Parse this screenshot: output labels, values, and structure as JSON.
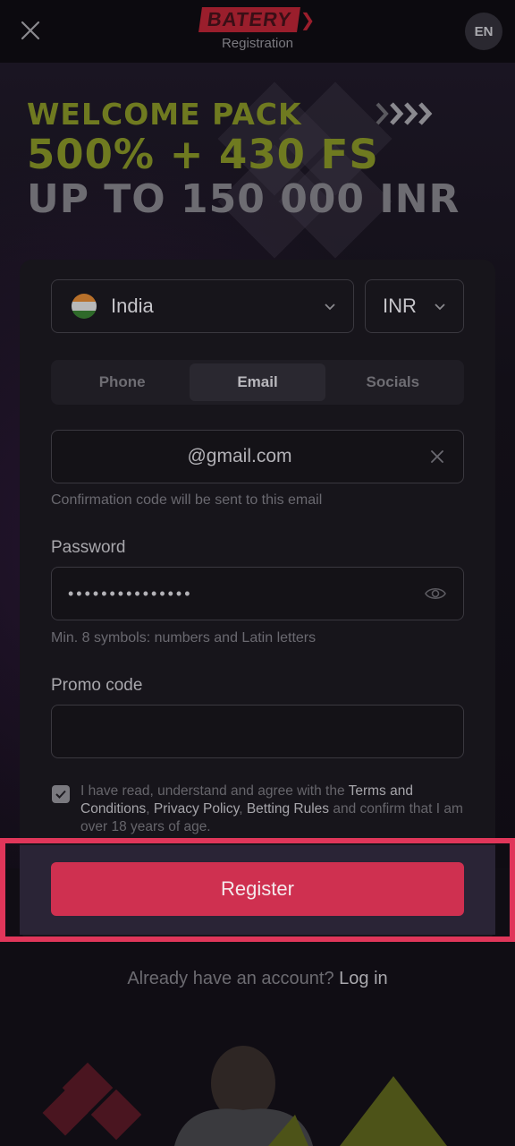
{
  "header": {
    "logo_text": "BATERY",
    "subtitle": "Registration",
    "lang": "EN"
  },
  "promo": {
    "line1": "WELCOME PACK",
    "line2": "500% + 430 FS",
    "line3": "UP TO 150 000 INR",
    "chevrons": ">>>>"
  },
  "form": {
    "country": "India",
    "currency": "INR",
    "tabs": [
      {
        "label": "Phone",
        "active": false
      },
      {
        "label": "Email",
        "active": true
      },
      {
        "label": "Socials",
        "active": false
      }
    ],
    "email_value": "@gmail.com",
    "email_hint": "Confirmation code will be sent to this email",
    "password_label": "Password",
    "password_value": "•••••••••••••••",
    "password_hint": "Min. 8 symbols: numbers and Latin letters",
    "promo_label": "Promo code",
    "promo_value": "",
    "consent": {
      "checked": true,
      "text_1": "I have read, understand and agree with the ",
      "link_terms": "Terms and Conditions",
      "sep_1": ", ",
      "link_privacy": "Privacy Policy",
      "sep_2": ", ",
      "link_rules": "Betting Rules",
      "text_2": " and confirm that I am over 18 years of age."
    },
    "register_label": "Register"
  },
  "login": {
    "prompt": "Already have an account? ",
    "link": "Log in"
  },
  "colors": {
    "accent": "#cf3050",
    "highlight_frame": "#e0365a",
    "promo_yellow": "#6f7a20"
  }
}
